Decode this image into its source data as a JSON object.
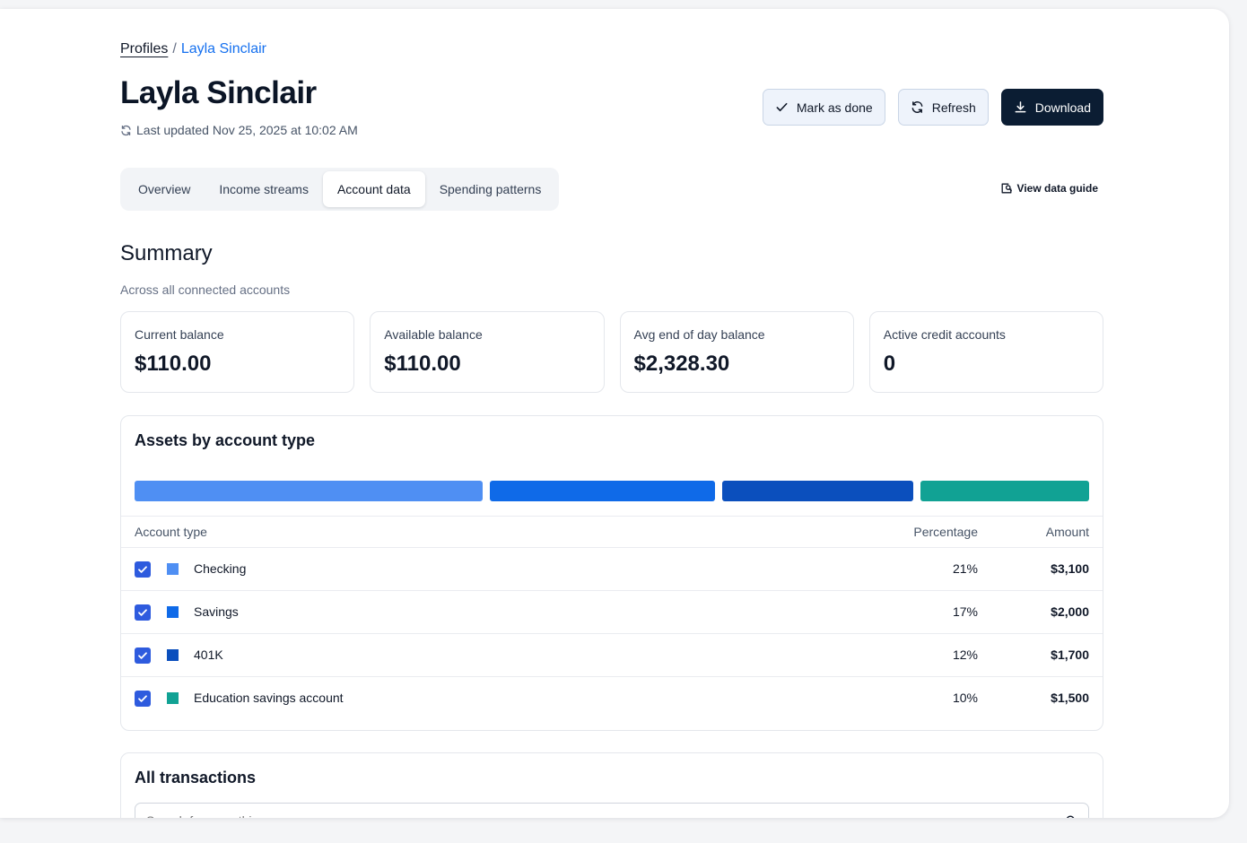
{
  "breadcrumb": {
    "root": "Profiles",
    "separator": "/",
    "current": "Layla Sinclair"
  },
  "header": {
    "title": "Layla Sinclair",
    "updated": "Last updated Nov 25, 2025 at 10:02 AM",
    "actions": {
      "mark_done": "Mark as done",
      "refresh": "Refresh",
      "download": "Download"
    }
  },
  "tabs": [
    {
      "label": "Overview",
      "active": false
    },
    {
      "label": "Income streams",
      "active": false
    },
    {
      "label": "Account data",
      "active": true
    },
    {
      "label": "Spending patterns",
      "active": false
    }
  ],
  "guide_link": "View data guide",
  "summary": {
    "title": "Summary",
    "subtitle": "Across all connected accounts",
    "stats": [
      {
        "label": "Current balance",
        "value": "$110.00"
      },
      {
        "label": "Available balance",
        "value": "$110.00"
      },
      {
        "label": "Avg end of day balance",
        "value": "$2,328.30"
      },
      {
        "label": "Active credit accounts",
        "value": "0"
      }
    ]
  },
  "assets": {
    "title": "Assets by account type",
    "columns": {
      "type": "Account type",
      "percentage": "Percentage",
      "amount": "Amount"
    },
    "rows": [
      {
        "name": "Checking",
        "percentage": "21%",
        "amount": "$3,100",
        "color": "#4f8ff3",
        "value": 3100,
        "checked": true
      },
      {
        "name": "Savings",
        "percentage": "17%",
        "amount": "$2,000",
        "color": "#0f6ae8",
        "value": 2000,
        "checked": true
      },
      {
        "name": "401K",
        "percentage": "12%",
        "amount": "$1,700",
        "color": "#0b4fbd",
        "value": 1700,
        "checked": true
      },
      {
        "name": "Education savings account",
        "percentage": "10%",
        "amount": "$1,500",
        "color": "#11a294",
        "value": 1500,
        "checked": true
      }
    ]
  },
  "transactions": {
    "title": "All transactions",
    "search_placeholder": "Search for something"
  }
}
